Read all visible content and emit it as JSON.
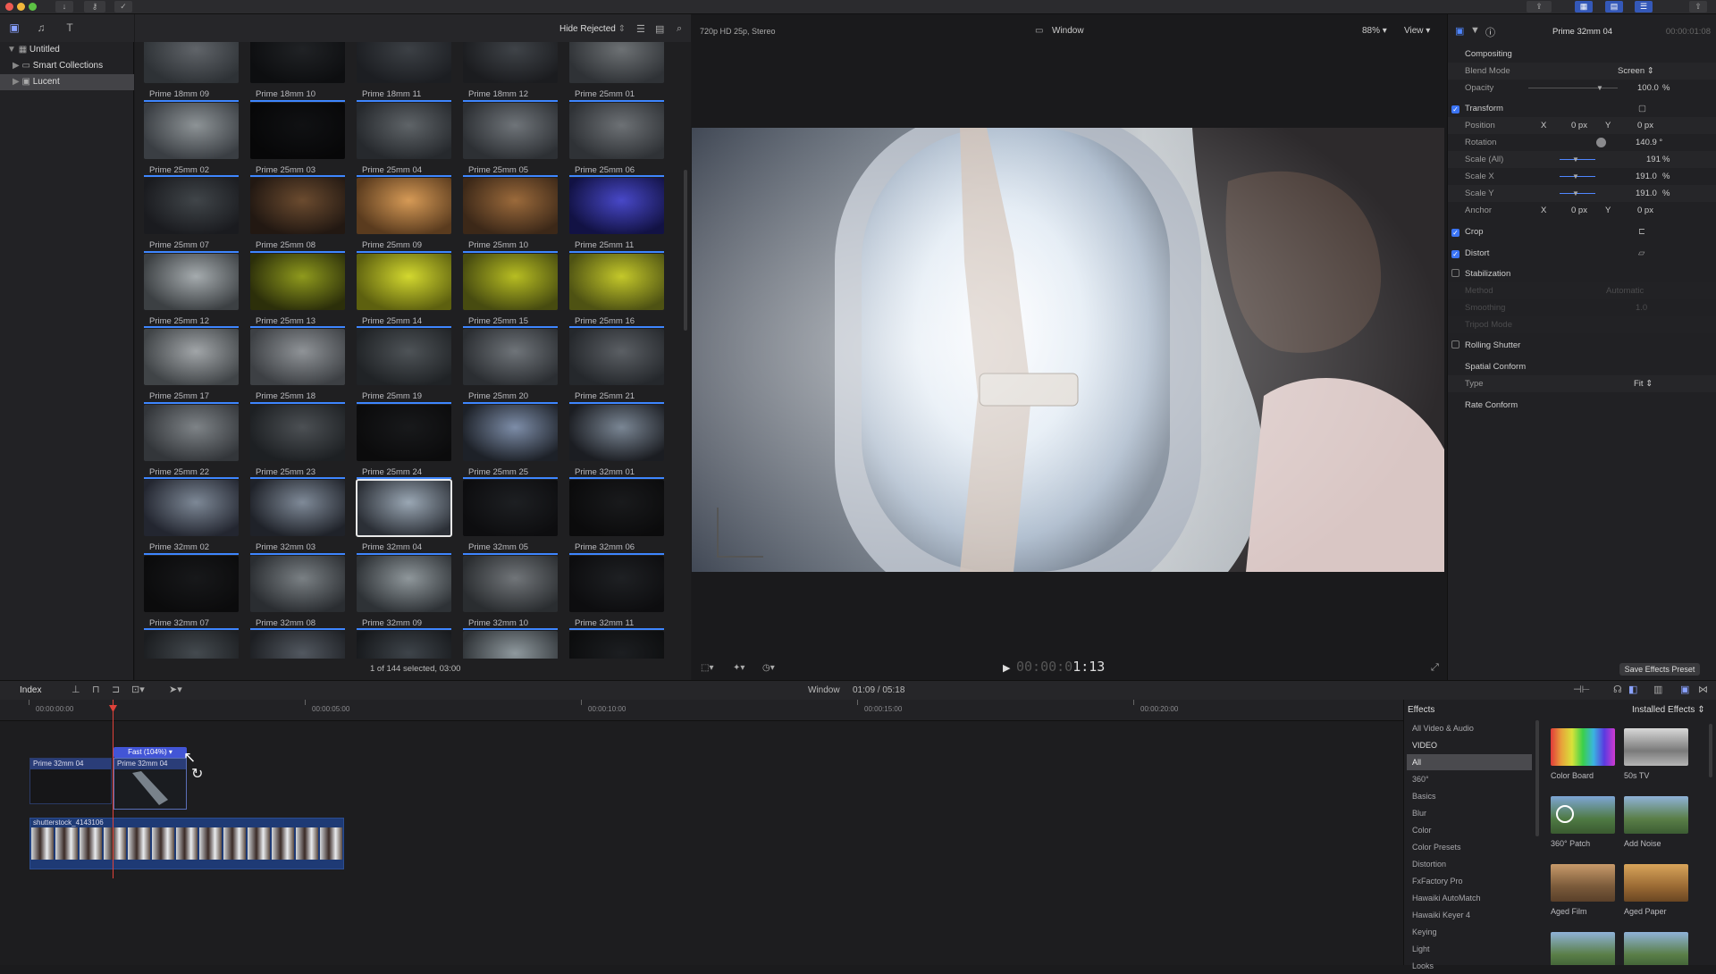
{
  "library": {
    "items": [
      {
        "label": "Untitled"
      },
      {
        "label": "Smart Collections"
      },
      {
        "label": "Lucent"
      }
    ]
  },
  "browser": {
    "filter_label": "Hide Rejected",
    "status": "1 of 144 selected, 03:00",
    "clips": [
      "Prime 18mm 09",
      "Prime 18mm 10",
      "Prime 18mm 11",
      "Prime 18mm 12",
      "Prime 25mm 01",
      "Prime 25mm 02",
      "Prime 25mm 03",
      "Prime 25mm 04",
      "Prime 25mm 05",
      "Prime 25mm 06",
      "Prime 25mm 07",
      "Prime 25mm 08",
      "Prime 25mm 09",
      "Prime 25mm 10",
      "Prime 25mm 11",
      "Prime 25mm 12",
      "Prime 25mm 13",
      "Prime 25mm 14",
      "Prime 25mm 15",
      "Prime 25mm 16",
      "Prime 25mm 17",
      "Prime 25mm 18",
      "Prime 25mm 19",
      "Prime 25mm 20",
      "Prime 25mm 21",
      "Prime 25mm 22",
      "Prime 25mm 23",
      "Prime 25mm 24",
      "Prime 25mm 25",
      "Prime 32mm 01",
      "Prime 32mm 02",
      "Prime 32mm 03",
      "Prime 32mm 04",
      "Prime 32mm 05",
      "Prime 32mm 06",
      "Prime 32mm 07",
      "Prime 32mm 08",
      "Prime 32mm 09",
      "Prime 32mm 10",
      "Prime 32mm 11"
    ],
    "selected_clip": "Prime 32mm 04"
  },
  "viewer": {
    "format": "720p HD 25p, Stereo",
    "window_label": "Window",
    "zoom": "88%",
    "view_label": "View",
    "timecode_dim": "00:00:0",
    "timecode_bright": "1:13"
  },
  "inspector": {
    "clip_name": "Prime 32mm 04",
    "duration": "00:00:01:08",
    "compositing": "Compositing",
    "blend_mode_label": "Blend Mode",
    "blend_mode_value": "Screen",
    "opacity_label": "Opacity",
    "opacity_value": "100.0",
    "opacity_unit": "%",
    "transform": "Transform",
    "position_label": "Position",
    "x_label": "X",
    "y_label": "Y",
    "position_x": "0 px",
    "position_y": "0 px",
    "rotation_label": "Rotation",
    "rotation_value": "140.9 °",
    "scale_all_label": "Scale (All)",
    "scale_all_value": "191",
    "scale_x_label": "Scale X",
    "scale_x_value": "191.0",
    "scale_y_label": "Scale Y",
    "scale_y_value": "191.0",
    "pct": "%",
    "anchor_label": "Anchor",
    "anchor_x": "0 px",
    "anchor_y": "0 px",
    "crop": "Crop",
    "distort": "Distort",
    "stabilization": "Stabilization",
    "method_label": "Method",
    "method_value": "Automatic",
    "smoothing_label": "Smoothing",
    "smoothing_value": "1.0",
    "tripod_label": "Tripod Mode",
    "rolling_shutter": "Rolling Shutter",
    "spatial_conform": "Spatial Conform",
    "type_label": "Type",
    "type_value": "Fit",
    "rate_conform": "Rate Conform",
    "save_preset": "Save Effects Preset"
  },
  "timeline": {
    "index_label": "Index",
    "window_label": "Window",
    "position": "01:09 / 05:18",
    "ruler": [
      "00:00:00:00",
      "00:00:05:00",
      "00:00:10:00",
      "00:00:15:00",
      "00:00:20:00"
    ],
    "clip_a": "Prime 32mm 04",
    "clip_b": "Prime 32mm 04",
    "retime_label": "Fast (104%)",
    "primary_clip": "shutterstock_4143106"
  },
  "effects": {
    "title": "Effects",
    "installed": "Installed Effects",
    "categories": [
      "All Video & Audio",
      "VIDEO",
      "All",
      "360°",
      "Basics",
      "Blur",
      "Color",
      "Color Presets",
      "Distortion",
      "FxFactory Pro",
      "Hawaiki AutoMatch",
      "Hawaiki Keyer 4",
      "Keying",
      "Light",
      "Looks"
    ],
    "tiles": [
      "Color Board",
      "50s TV",
      "360° Patch",
      "Add Noise",
      "Aged Film",
      "Aged Paper",
      "",
      ""
    ]
  },
  "colors": {
    "accent": "#3e86ff",
    "selection": "#3b74f5",
    "playhead": "#e0423a"
  }
}
